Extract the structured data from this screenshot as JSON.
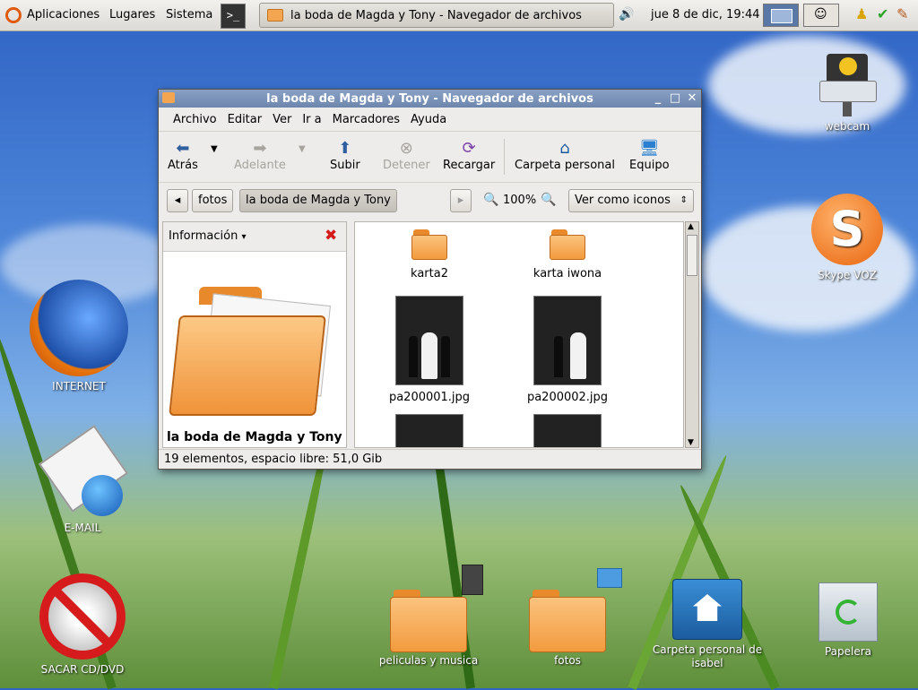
{
  "panel": {
    "menus": [
      "Aplicaciones",
      "Lugares",
      "Sistema"
    ],
    "task_title": "la boda de Magda y Tony - Navegador de archivos",
    "clock": "jue  8 de dic, 19:44"
  },
  "window": {
    "title": "la boda de Magda y Tony - Navegador de archivos",
    "menu": [
      "Archivo",
      "Editar",
      "Ver",
      "Ir a",
      "Marcadores",
      "Ayuda"
    ],
    "toolbar": {
      "back": "Atrás",
      "forward": "Adelante",
      "up": "Subir",
      "stop": "Detener",
      "reload": "Recargar",
      "home": "Carpeta personal",
      "computer": "Equipo"
    },
    "location": {
      "crumbs": [
        "fotos",
        "la boda de Magda y Tony"
      ],
      "zoom": "100%",
      "view_mode": "Ver como iconos"
    },
    "sidepane": {
      "selector": "Información",
      "folder_name": "la boda de Magda y Tony"
    },
    "items": [
      "karta2",
      "karta iwona",
      "pa200001.jpg",
      "pa200002.jpg"
    ],
    "status": "19 elementos, espacio libre: 51,0 Gib"
  },
  "desktop_icons": {
    "webcam": "webcam",
    "skype": "Skype VOZ",
    "internet": "INTERNET",
    "email": "E-MAIL",
    "eject": "SACAR CD/DVD",
    "movies": "peliculas y musica",
    "photos": "fotos",
    "home": "Carpeta personal de isabel",
    "trash": "Papelera"
  }
}
